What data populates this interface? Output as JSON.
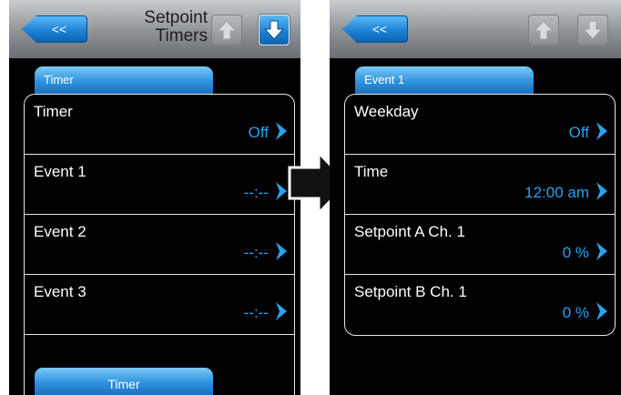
{
  "left": {
    "back_label": "<<",
    "title_line1": "Setpoint",
    "title_line2": "Timers",
    "tab_label": "Timer",
    "rows": [
      {
        "label": "Timer",
        "value": "Off"
      },
      {
        "label": "Event 1",
        "value": "--:--"
      },
      {
        "label": "Event 2",
        "value": "--:--"
      },
      {
        "label": "Event 3",
        "value": "--:--"
      }
    ],
    "bottom_tab_label": "Timer"
  },
  "right": {
    "back_label": "<<",
    "tab_label": "Event 1",
    "rows": [
      {
        "label": "Weekday",
        "value": "Off"
      },
      {
        "label": "Time",
        "value": "12:00 am"
      },
      {
        "label": "Setpoint A Ch. 1",
        "value": "0 %"
      },
      {
        "label": "Setpoint B Ch. 1",
        "value": "0 %"
      }
    ]
  },
  "colors": {
    "accent_blue": "#29a3f0",
    "button_blue": "#1a7fd4",
    "background": "#000000"
  }
}
